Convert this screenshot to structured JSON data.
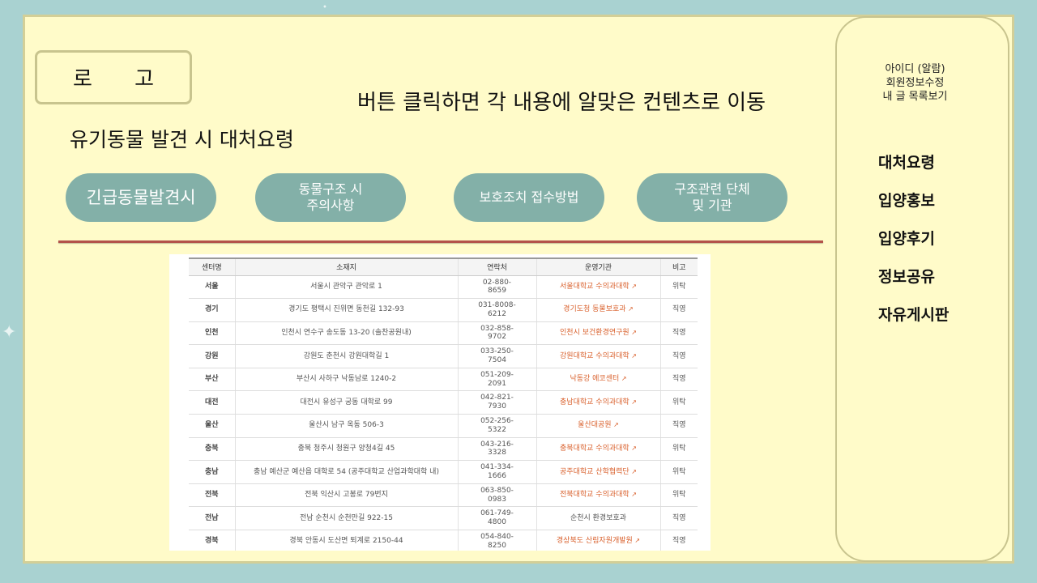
{
  "logo": {
    "label": "로 고"
  },
  "instruction": "버튼 클릭하면 각 내용에 알맞은 컨텐츠로 이동",
  "page_title": "유기동물 발견 시 대처요령",
  "buttons": [
    {
      "label": "긴급동물발견시"
    },
    {
      "line1": "동물구조 시",
      "line2": "주의사항"
    },
    {
      "label": "보호조치 접수방법"
    },
    {
      "line1": "구조관련 단체",
      "line2": "및 기관"
    }
  ],
  "user_menu": {
    "alarm": "아이디 (알람)",
    "edit_profile": "회원정보수정",
    "my_posts": "내 글 목록보기"
  },
  "sidebar_menu": [
    "대처요령",
    "입양홍보",
    "입양후기",
    "정보공유",
    "자유게시판"
  ],
  "table": {
    "headers": [
      "센터명",
      "소재지",
      "연락처",
      "운영기관",
      "비고"
    ],
    "rows": [
      {
        "region": "서울",
        "address": "서울시 관악구 관악로 1",
        "phone1": "02-880-",
        "phone2": "8659",
        "agency": "서울대학교 수의과대학",
        "link": true,
        "note": "위탁"
      },
      {
        "region": "경기",
        "address": "경기도 평택시 진위면 동천길 132-93",
        "phone1": "031-8008-",
        "phone2": "6212",
        "agency": "경기도청 동물보호과",
        "link": true,
        "note": "직영"
      },
      {
        "region": "인천",
        "address": "인천시 연수구 송도동 13-20 (솔찬공원내)",
        "phone1": "032-858-",
        "phone2": "9702",
        "agency": "인천시 보건환경연구원",
        "link": true,
        "note": "직영"
      },
      {
        "region": "강원",
        "address": "강원도 춘천시 강원대학길 1",
        "phone1": "033-250-",
        "phone2": "7504",
        "agency": "강원대학교 수의과대학",
        "link": true,
        "note": "직영"
      },
      {
        "region": "부산",
        "address": "부산시 사하구 낙동남로 1240-2",
        "phone1": "051-209-",
        "phone2": "2091",
        "agency": "낙동강 에코센터",
        "link": true,
        "note": "직영"
      },
      {
        "region": "대전",
        "address": "대전시 유성구 궁동 대학로 99",
        "phone1": "042-821-",
        "phone2": "7930",
        "agency": "충남대학교 수의과대학",
        "link": true,
        "note": "위탁"
      },
      {
        "region": "울산",
        "address": "울산시 남구 옥동 506-3",
        "phone1": "052-256-",
        "phone2": "5322",
        "agency": "울산대공원",
        "link": true,
        "note": "직영"
      },
      {
        "region": "충북",
        "address": "충북 청주시 청원구 양청4길 45",
        "phone1": "043-216-",
        "phone2": "3328",
        "agency": "충북대학교 수의과대학",
        "link": true,
        "note": "위탁"
      },
      {
        "region": "충남",
        "address": "충남 예산군 예산읍 대학로 54 (공주대학교 산업과학대학 내)",
        "phone1": "041-334-",
        "phone2": "1666",
        "agency": "공주대학교 산학협력단",
        "link": true,
        "note": "위탁"
      },
      {
        "region": "전북",
        "address": "전북 익산시 고봉로 79번지",
        "phone1": "063-850-",
        "phone2": "0983",
        "agency": "전북대학교 수의과대학",
        "link": true,
        "note": "위탁"
      },
      {
        "region": "전남",
        "address": "전남 순천시 순천만길 922-15",
        "phone1": "061-749-",
        "phone2": "4800",
        "agency": "순천시 환경보호과",
        "link": false,
        "note": "직영"
      },
      {
        "region": "경북",
        "address": "경북 안동시 도산면 퇴계로 2150-44",
        "phone1": "054-840-",
        "phone2": "8250",
        "agency": "경상북도 산림자원개발원",
        "link": true,
        "note": "직영"
      }
    ]
  },
  "colors": {
    "background": "#a9d2d1",
    "canvas": "#fffbc9",
    "button": "#83b0a8",
    "divider": "#b3524a",
    "link": "#d9602c"
  }
}
